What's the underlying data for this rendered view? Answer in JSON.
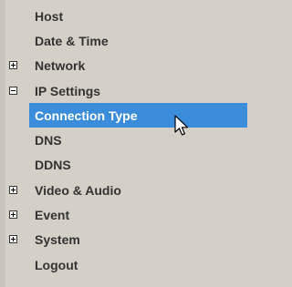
{
  "menu": {
    "items": [
      {
        "label": "Host",
        "toggle": "none"
      },
      {
        "label": "Date & Time",
        "toggle": "none"
      },
      {
        "label": "Network",
        "toggle": "plus"
      },
      {
        "label": "IP Settings",
        "toggle": "minus"
      },
      {
        "label": "Connection Type",
        "toggle": "none",
        "selected": true
      },
      {
        "label": "DNS",
        "toggle": "none"
      },
      {
        "label": "DDNS",
        "toggle": "none"
      },
      {
        "label": "Video & Audio",
        "toggle": "plus"
      },
      {
        "label": "Event",
        "toggle": "plus"
      },
      {
        "label": "System",
        "toggle": "plus"
      },
      {
        "label": "Logout",
        "toggle": "none"
      }
    ]
  },
  "colors": {
    "background": "#d4d0c8",
    "selection": "#3b8cdb",
    "text": "#333333",
    "selected_text": "#ffffff"
  },
  "icons": {
    "expand": "plus-box-icon",
    "collapse": "minus-box-icon",
    "pointer": "mouse-cursor-icon"
  }
}
